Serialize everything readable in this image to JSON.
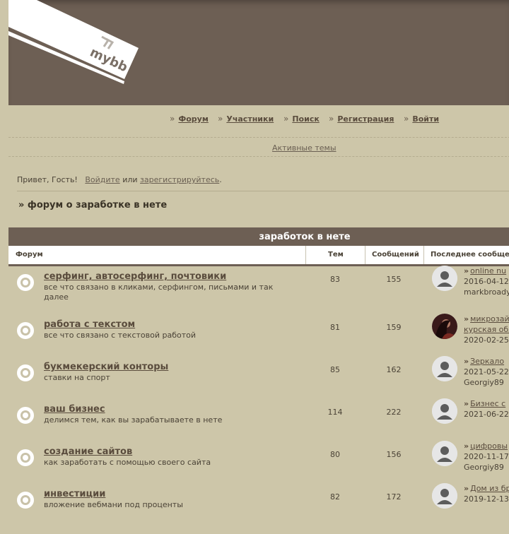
{
  "header": {
    "logo_text": "mybb",
    "colors": {
      "header_bg": "#6d5f54",
      "page_bg": "#cdc6a9"
    }
  },
  "nav": {
    "items": [
      {
        "label": "Форум"
      },
      {
        "label": "Участники"
      },
      {
        "label": "Поиск"
      },
      {
        "label": "Регистрация"
      },
      {
        "label": "Войти"
      }
    ]
  },
  "active_topics": "Активные темы",
  "welcome": {
    "greeting": "Привет, Гость!",
    "login": "Войдите",
    "or": "или",
    "register": "зарегистрируйтесь",
    "dot": "."
  },
  "breadcrumb": "» форум о заработке в нете",
  "category": {
    "title": "заработок в нете",
    "columns": {
      "forum": "Форум",
      "topics": "Тем",
      "posts": "Сообщений",
      "last_post": "Последнее сообщение"
    }
  },
  "forums": [
    {
      "title": "серфинг, автосерфинг, почтовики",
      "desc": "все что связано в кликами, серфингом, письмами и так далее",
      "topics": "83",
      "posts": "155",
      "last_title": "online nu",
      "last_date": "2016-04-12",
      "last_user": "markbroady",
      "avatar": "default-avatar-icon"
    },
    {
      "title": "работа с текстом",
      "desc": "все что связано с текстовой работой",
      "topics": "81",
      "posts": "159",
      "last_title": "микрозай",
      "last_date": "курская обл",
      "last_user": "2020-02-25",
      "avatar": "user-photo-avatar"
    },
    {
      "title": "букмекерский конторы",
      "desc": "ставки на спорт",
      "topics": "85",
      "posts": "162",
      "last_title": "Зеркало",
      "last_date": "2021-05-22",
      "last_user": "Georgiy89",
      "avatar": "default-avatar-icon"
    },
    {
      "title": "ваш бизнес",
      "desc": "делимся тем, как вы зарабатываете в нете",
      "topics": "114",
      "posts": "222",
      "last_title": "Бизнес с",
      "last_date": "2021-06-22",
      "last_user": "",
      "avatar": "default-avatar-icon"
    },
    {
      "title": "создание сайтов",
      "desc": "как заработать с помощью своего сайта",
      "topics": "80",
      "posts": "156",
      "last_title": "цифровы",
      "last_date": "2020-11-17",
      "last_user": "Georgiy89",
      "avatar": "default-avatar-icon"
    },
    {
      "title": "инвестиции",
      "desc": "вложение вебмани под проценты",
      "topics": "82",
      "posts": "172",
      "last_title": "Дом из бр",
      "last_date": "2019-12-13",
      "last_user": "",
      "avatar": "default-avatar-icon"
    }
  ]
}
